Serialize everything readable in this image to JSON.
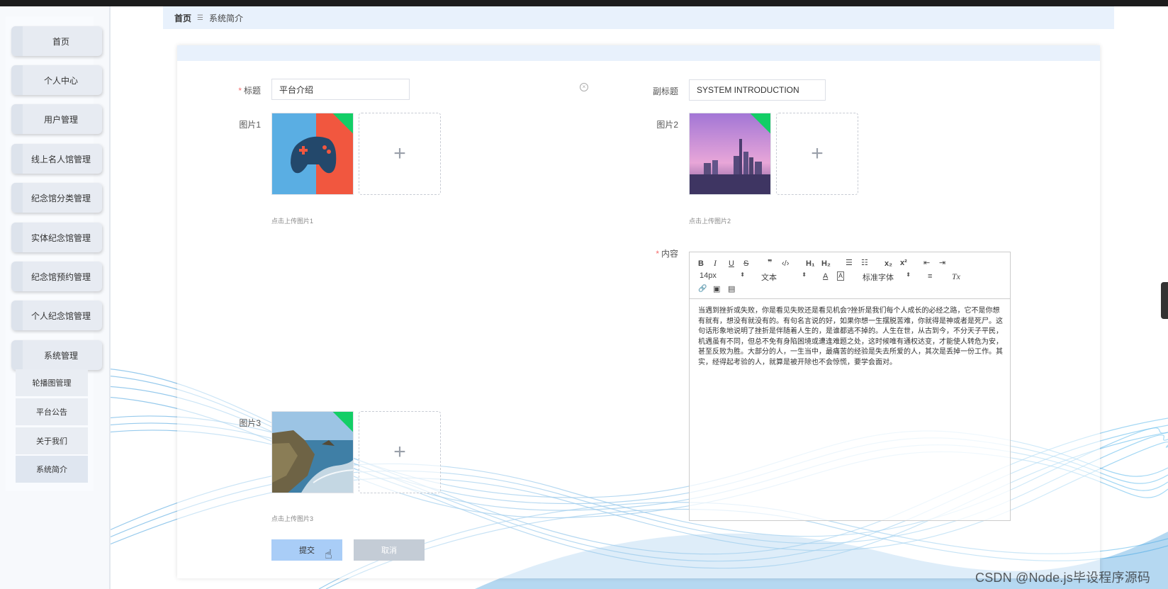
{
  "breadcrumb": {
    "home": "首页",
    "separator": "☰",
    "current": "系统简介"
  },
  "sidebar": {
    "items": [
      {
        "label": "首页"
      },
      {
        "label": "个人中心"
      },
      {
        "label": "用户管理"
      },
      {
        "label": "线上名人馆管理"
      },
      {
        "label": "纪念馆分类管理"
      },
      {
        "label": "实体纪念馆管理"
      },
      {
        "label": "纪念馆预约管理"
      },
      {
        "label": "个人纪念馆管理"
      },
      {
        "label": "系统管理"
      }
    ],
    "sub_items": [
      {
        "label": "轮播图管理"
      },
      {
        "label": "平台公告"
      },
      {
        "label": "关于我们"
      },
      {
        "label": "系统简介"
      }
    ]
  },
  "form": {
    "title_label": "标题",
    "title_value": "平台介绍",
    "subtitle_label": "副标题",
    "subtitle_value": "SYSTEM INTRODUCTION",
    "picture1_label": "图片1",
    "picture1_hint": "点击上传图片1",
    "picture2_label": "图片2",
    "picture2_hint": "点击上传图片2",
    "picture3_label": "图片3",
    "picture3_hint": "点击上传图片3",
    "content_label": "内容",
    "required_mark": "*",
    "upload_plus": "+",
    "clear_icon": "×"
  },
  "editor": {
    "toolbar": {
      "bold": "B",
      "italic": "I",
      "underline": "U",
      "strike": "S",
      "quote": "❞",
      "code": "‹/›",
      "h1": "H₁",
      "h2": "H₂",
      "ordered_list": "☰",
      "bullet_list": "☷",
      "subscript": "x₂",
      "superscript": "x²",
      "outdent": "⇤",
      "indent": "⇥",
      "font_size": "14px",
      "paragraph": "文本",
      "font_color": "A",
      "bg_color": "A",
      "font_family": "标准字体",
      "align": "≡",
      "clean": "Tx",
      "link": "🔗",
      "image": "▣",
      "video": "▤",
      "select_arrow": "⬍"
    },
    "content": "当遇到挫折或失败，你是看见失败还是看见机会?挫折是我们每个人成长的必经之路，它不是你想有就有，想没有就没有的。有句名言说的好，如果你想一生摆脱苦难，你就得是神或者是死尸。这句话形象地说明了挫折是伴随着人生的，是谁都逃不掉的。人生在世，从古到今，不分天子平民，机遇虽有不同，但总不免有身陷困境或遭逢难题之处，这时候唯有通权达变，才能使人转危为安，甚至反败为胜。大部分的人，一生当中，最痛苦的经验是失去所爱的人，其次是丢掉一份工作。其实，经得起考验的人，就算是被开除也不会惊慌，要学会面对。"
  },
  "buttons": {
    "submit": "提交",
    "cancel": "取消"
  },
  "watermark": "CSDN @Node.js毕设程序源码",
  "colors": {
    "accent": "#a9cdf7",
    "breadcrumb_bg": "#e8f1fc",
    "required": "#f56c6c",
    "uploaded_corner": "#13ce66"
  }
}
